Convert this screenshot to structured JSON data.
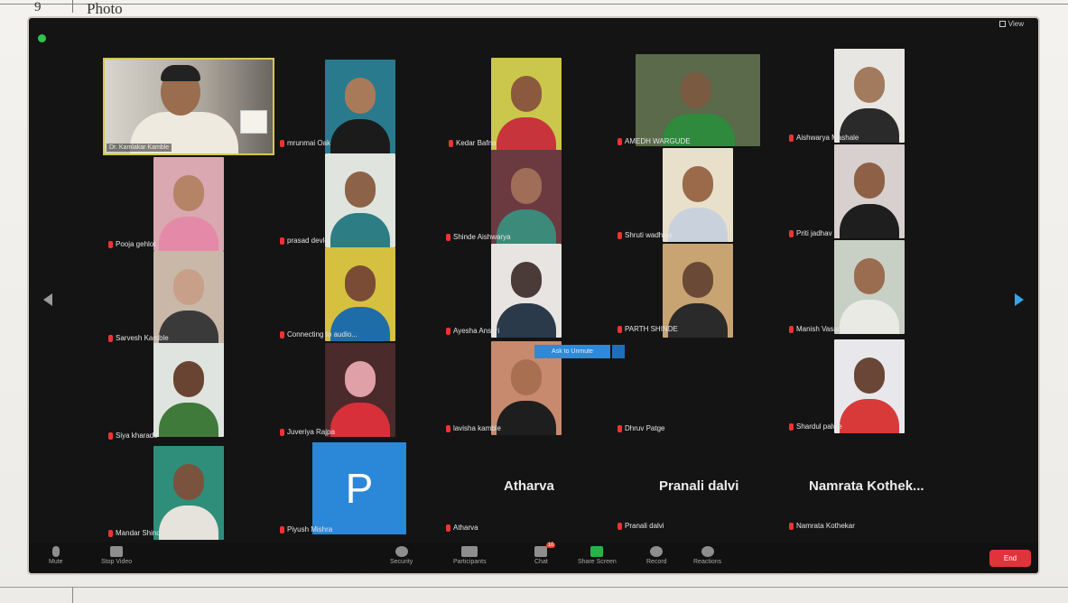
{
  "paper": {
    "row_number": "9",
    "heading": "Photo"
  },
  "window": {
    "view_label": "View"
  },
  "host": {
    "name": "Dr. Kamlakar Kamble"
  },
  "participants": [
    {
      "name": "mrunmai Oak"
    },
    {
      "name": "Kedar Bafna"
    },
    {
      "name": "AMEDH WARGUDE"
    },
    {
      "name": "Aishwarya Mashale"
    },
    {
      "name": "Pooja gehlot"
    },
    {
      "name": "prasad devle"
    },
    {
      "name": "Shinde Aishwarya"
    },
    {
      "name": "Shruti wadhwa"
    },
    {
      "name": "Priti jadhav"
    },
    {
      "name": "Sarvesh Kamble"
    },
    {
      "name": "Connecting to audio..."
    },
    {
      "name": "Ayesha Ansari"
    },
    {
      "name": "PARTH SHINDE"
    },
    {
      "name": "Manish Vasantrao..."
    },
    {
      "name": "Siya kharade"
    },
    {
      "name": "Juveriya Rajpa"
    },
    {
      "name": "lavisha kamble"
    },
    {
      "name": "Dhruv Patge"
    },
    {
      "name": "Shardul palwe"
    },
    {
      "name": "Mandar Shinde"
    },
    {
      "name": "Piyush Mishra"
    },
    {
      "name": "Atharva"
    },
    {
      "name": "Pranali dalvi"
    },
    {
      "name": "Namrata Kothekar"
    }
  ],
  "tiles_no_video": [
    {
      "name": "Atharva"
    },
    {
      "name": "Pranali dalvi"
    },
    {
      "name": "Namrata  Kothek..."
    }
  ],
  "avatar_letter": "P",
  "hover_chip": {
    "label": "Ask to Unmute"
  },
  "toolbar": {
    "items": [
      {
        "label": "Mute",
        "icon": "microphone-icon"
      },
      {
        "label": "Stop Video",
        "icon": "video-camera-icon"
      },
      {
        "label": "Security",
        "icon": "shield-icon"
      },
      {
        "label": "Participants",
        "icon": "participants-icon"
      },
      {
        "label": "Chat",
        "icon": "chat-icon",
        "badge": "10"
      },
      {
        "label": "Share Screen",
        "icon": "share-screen-icon"
      },
      {
        "label": "Record",
        "icon": "record-icon"
      },
      {
        "label": "Reactions",
        "icon": "reactions-icon"
      }
    ],
    "end_label": "End"
  },
  "colors": {
    "window_bg": "#141414",
    "host_border": "#d8c84a",
    "avatar_blue": "#2b87d8",
    "end_red": "#e0333a",
    "share_green": "#28b34a",
    "nav_right_blue": "#35a5e8"
  }
}
